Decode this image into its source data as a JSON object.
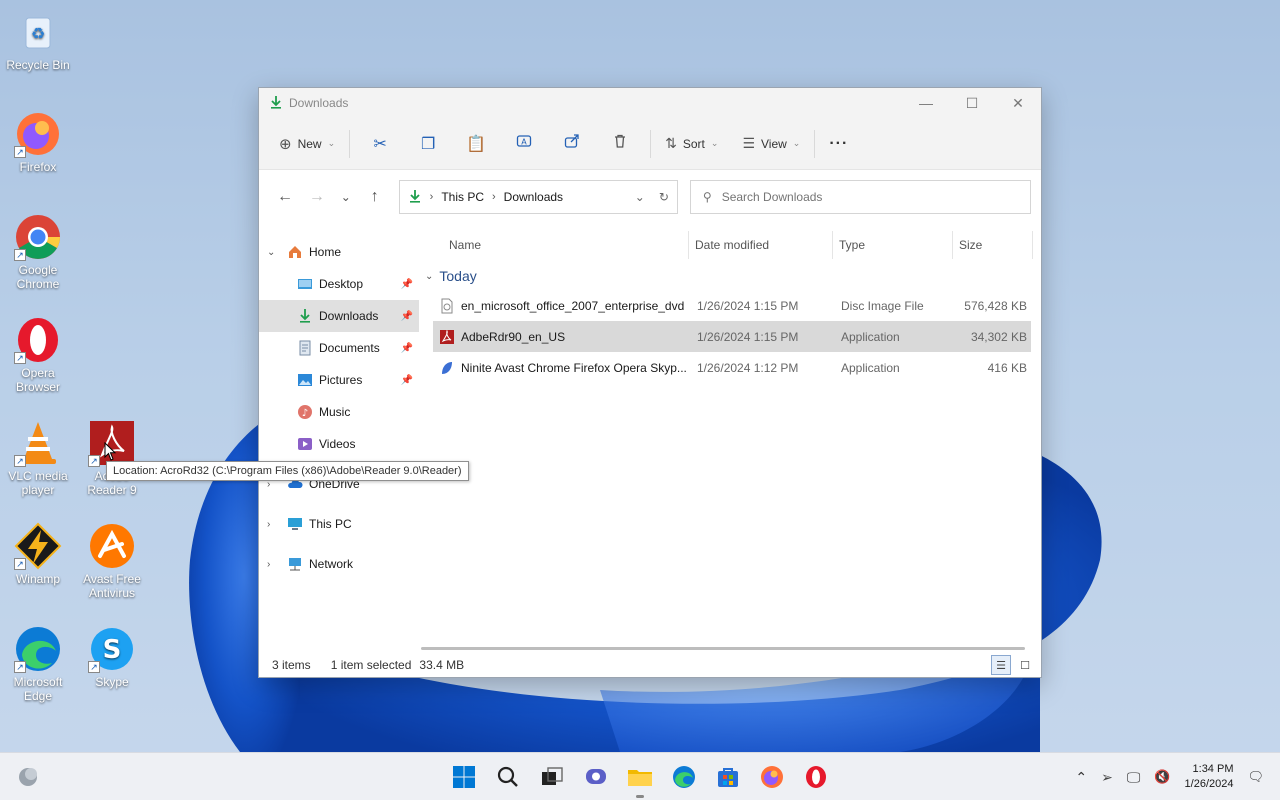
{
  "desktop": {
    "icons": [
      {
        "label_l1": "Recycle Bin",
        "label_l2": "",
        "icon": "recycle-bin-icon"
      },
      {
        "label_l1": "Firefox",
        "label_l2": "",
        "icon": "firefox-icon"
      },
      {
        "label_l1": "Google",
        "label_l2": "Chrome",
        "icon": "chrome-icon"
      },
      {
        "label_l1": "Opera",
        "label_l2": "Browser",
        "icon": "opera-icon"
      },
      {
        "label_l1": "VLC media",
        "label_l2": "player",
        "icon": "vlc-icon"
      },
      {
        "label_l1": "Adobe",
        "label_l2": "Reader 9",
        "icon": "adobe-reader-icon"
      },
      {
        "label_l1": "Winamp",
        "label_l2": "",
        "icon": "winamp-icon"
      },
      {
        "label_l1": "Avast Free",
        "label_l2": "Antivirus",
        "icon": "avast-icon"
      },
      {
        "label_l1": "Microsoft",
        "label_l2": "Edge",
        "icon": "edge-icon"
      },
      {
        "label_l1": "Skype",
        "label_l2": "",
        "icon": "skype-icon"
      }
    ],
    "tooltip": "Location: AcroRd32 (C:\\Program Files (x86)\\Adobe\\Reader 9.0\\Reader)"
  },
  "window": {
    "title": "Downloads",
    "toolbar": {
      "new_label": "New",
      "sort_label": "Sort",
      "view_label": "View",
      "more_label": "···"
    },
    "address": {
      "crumbs": [
        "This PC",
        "Downloads"
      ],
      "search_placeholder": "Search Downloads"
    },
    "nav": {
      "home": "Home",
      "quick": [
        {
          "label": "Desktop",
          "pinned": true
        },
        {
          "label": "Downloads",
          "pinned": true
        },
        {
          "label": "Documents",
          "pinned": true
        },
        {
          "label": "Pictures",
          "pinned": true
        },
        {
          "label": "Music",
          "pinned": false
        },
        {
          "label": "Videos",
          "pinned": false
        }
      ],
      "onedrive": "OneDrive",
      "thispc": "This PC",
      "network": "Network"
    },
    "columns": {
      "name": "Name",
      "date": "Date modified",
      "type": "Type",
      "size": "Size"
    },
    "group": "Today",
    "files": [
      {
        "name": "en_microsoft_office_2007_enterprise_dvd",
        "date": "1/26/2024 1:15 PM",
        "type": "Disc Image File",
        "size": "576,428 KB"
      },
      {
        "name": "AdbeRdr90_en_US",
        "date": "1/26/2024 1:15 PM",
        "type": "Application",
        "size": "34,302 KB"
      },
      {
        "name": "Ninite Avast Chrome Firefox Opera Skyp...",
        "date": "1/26/2024 1:12 PM",
        "type": "Application",
        "size": "416 KB"
      }
    ],
    "status": {
      "count": "3 items",
      "selection": "1 item selected",
      "size": "33.4 MB"
    }
  },
  "taskbar": {
    "time": "1:34 PM",
    "date": "1/26/2024"
  },
  "colors": {
    "accent": "#2461b5",
    "selection": "#d9d9d9",
    "taskbar": "#eef0f4"
  }
}
